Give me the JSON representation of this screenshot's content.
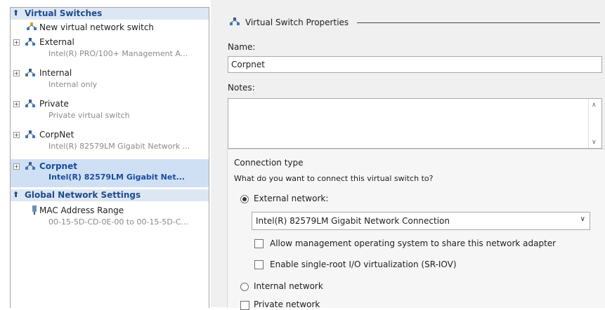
{
  "left_panel": {
    "virtual_switches_header": "Virtual Switches",
    "new_switch_label": "New virtual network switch",
    "switches": [
      {
        "name": "External",
        "detail": "Intel(R) PRO/100+ Management A..."
      },
      {
        "name": "Internal",
        "detail": "Internal only"
      },
      {
        "name": "Private",
        "detail": "Private virtual switch"
      },
      {
        "name": "CorpNet",
        "detail": "Intel(R) 82579LM Gigabit Network ..."
      },
      {
        "name": "Corpnet",
        "detail": "Intel(R) 82579LM Gigabit Net..."
      }
    ],
    "selected_index": 4,
    "global_header": "Global Network Settings",
    "mac_range_label": "MAC Address Range",
    "mac_range_value": "00-15-5D-CD-0E-00 to 00-15-5D-C..."
  },
  "right_panel": {
    "section_title": "Virtual Switch Properties",
    "name_label": "Name:",
    "name_value": "Corpnet",
    "notes_label": "Notes:",
    "notes_value": "",
    "connection_type_label": "Connection type",
    "connection_question": "What do you want to connect this virtual switch to?",
    "external_label": "External network:",
    "external_selected": true,
    "adapter_value": "Intel(R) 82579LM Gigabit Network Connection",
    "allow_mgmt_label": "Allow management operating system to share this network adapter",
    "allow_mgmt_checked": false,
    "sriov_label": "Enable single-root I/O virtualization (SR-IOV)",
    "sriov_checked": false,
    "internal_label": "Internal network",
    "private_label": "Private network"
  }
}
